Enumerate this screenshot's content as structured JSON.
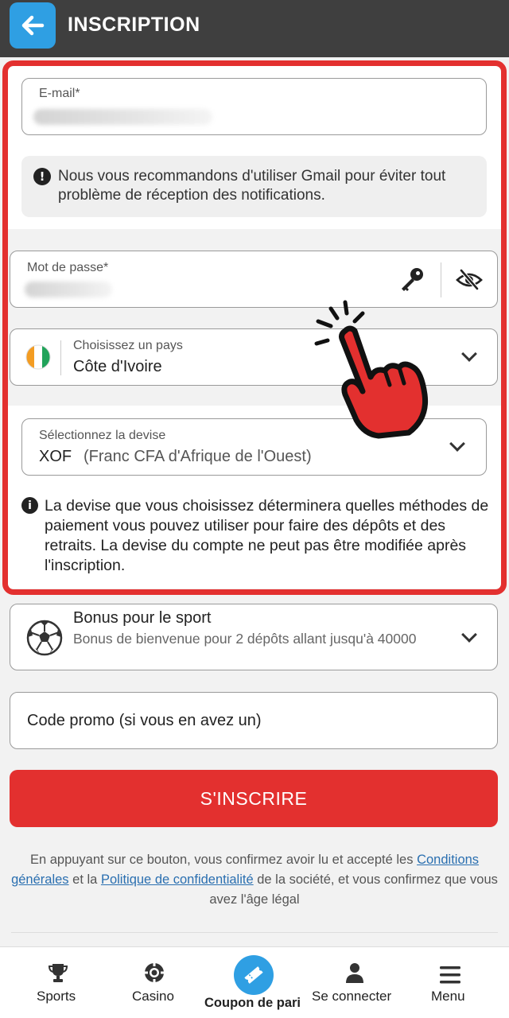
{
  "header": {
    "title": "INSCRIPTION"
  },
  "email": {
    "label": "E-mail*"
  },
  "gmail_notice": {
    "text": "Nous vous recommandons d'utiliser Gmail pour éviter tout problème de réception des notifications."
  },
  "password": {
    "label": "Mot de passe*"
  },
  "country": {
    "label": "Choisissez un pays",
    "value": "Côte d'Ivoire"
  },
  "currency": {
    "label": "Sélectionnez la devise",
    "code": "XOF",
    "name": "(Franc CFA d'Afrique de l'Ouest)"
  },
  "currency_note": {
    "text": "La devise que vous choisissez déterminera quelles méthodes de paiement vous pouvez utiliser pour faire des dépôts et des retraits. La devise du compte ne peut pas être modifiée après l'inscription."
  },
  "bonus": {
    "title": "Bonus pour le sport",
    "subtitle": "Bonus de bienvenue pour 2 dépôts allant jusqu'à 40000"
  },
  "promo": {
    "placeholder": "Code promo (si vous en avez un)"
  },
  "submit": {
    "label": "S'INSCRIRE"
  },
  "legal": {
    "part1": "En appuyant sur ce bouton, vous confirmez avoir lu et accepté les",
    "terms_link": "Conditions générales",
    "part2": "et la",
    "privacy_link": "Politique de confidentialité",
    "part3": "de la société, et vous confirmez que vous avez l'âge légal"
  },
  "nav": {
    "sports": "Sports",
    "casino": "Casino",
    "coupon": "Coupon de pari",
    "login": "Se connecter",
    "menu": "Menu"
  },
  "colors": {
    "accent_red": "#e3302f",
    "accent_blue": "#2f9fe3",
    "header_bg": "#3f3f3f"
  }
}
